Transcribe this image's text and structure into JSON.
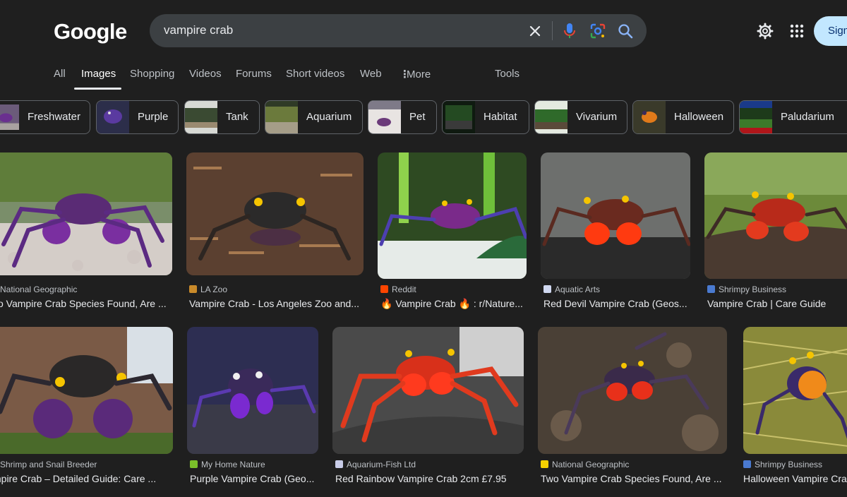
{
  "header": {
    "logo": "Google",
    "search_value": "vampire crab",
    "signin_label": "Sign in"
  },
  "tabs": [
    {
      "label": "All"
    },
    {
      "label": "Images"
    },
    {
      "label": "Shopping"
    },
    {
      "label": "Videos"
    },
    {
      "label": "Forums"
    },
    {
      "label": "Short videos"
    },
    {
      "label": "Web"
    },
    {
      "label": "More"
    },
    {
      "label": "Tools"
    }
  ],
  "chips": [
    {
      "label": "Freshwater"
    },
    {
      "label": "Purple"
    },
    {
      "label": "Tank"
    },
    {
      "label": "Aquarium"
    },
    {
      "label": "Pet"
    },
    {
      "label": "Habitat"
    },
    {
      "label": "Vivarium"
    },
    {
      "label": "Halloween"
    },
    {
      "label": "Paludarium"
    }
  ],
  "results": [
    {
      "source": "National Geographic",
      "title": "vo Vampire Crab Species Found, Are ..."
    },
    {
      "source": "LA Zoo",
      "title": "Vampire Crab - Los Angeles Zoo and..."
    },
    {
      "source": "Reddit",
      "title": "🔥 Vampire Crab 🔥 : r/Nature..."
    },
    {
      "source": "Aquatic Arts",
      "title": "Red Devil Vampire Crab (Geos..."
    },
    {
      "source": "Shrimpy Business",
      "title": "Vampire Crab | Care Guide"
    },
    {
      "source": "Shrimp and Snail Breeder",
      "title": "mpire Crab – Detailed Guide: Care ..."
    },
    {
      "source": "My Home Nature",
      "title": "Purple Vampire Crab (Geo..."
    },
    {
      "source": "Aquarium-Fish Ltd",
      "title": "Red Rainbow Vampire Crab 2cm £7.95"
    },
    {
      "source": "National Geographic",
      "title": "Two Vampire Crab Species Found, Are ..."
    },
    {
      "source": "Shrimpy Business",
      "title": "Halloween Vampire Cra"
    }
  ],
  "colors": {
    "background": "#1f1f1f",
    "search_bg": "#3c4043",
    "signin_bg": "#c2e7ff",
    "crab_purple": "#7b3fa8",
    "crab_red": "#e0301e"
  },
  "icons": [
    "clear-icon",
    "mic-icon",
    "lens-icon",
    "search-icon",
    "settings-icon",
    "apps-icon",
    "more-dots-icon"
  ]
}
